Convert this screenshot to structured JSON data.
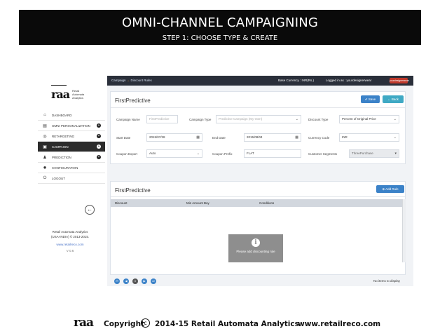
{
  "banner": {
    "title": "OMNI-CHANNEL CAMPAIGNING",
    "subtitle": "STEP 1: CHOOSE TYPE & CREATE"
  },
  "sidebar": {
    "logo_mark": "raa",
    "logo_sub": [
      "Retail",
      "Automata",
      "Analytics"
    ],
    "items": [
      {
        "label": "DASHBOARD",
        "icon": "home-icon",
        "glyph": "⌂",
        "expand": false,
        "active": false
      },
      {
        "label": "OMNI PERSONALIZATION",
        "icon": "cart-icon",
        "glyph": "🛒",
        "expand": true,
        "active": false
      },
      {
        "label": "RETARGETING",
        "icon": "target-icon",
        "glyph": "◎",
        "expand": true,
        "active": false
      },
      {
        "label": "CAMPAIGN",
        "icon": "document-icon",
        "glyph": "▣",
        "expand": true,
        "active": true
      },
      {
        "label": "PREDICTION",
        "icon": "user-icon",
        "glyph": "♟",
        "expand": true,
        "active": false
      },
      {
        "label": "CONFIGURATION",
        "icon": "gear-icon",
        "glyph": "✹",
        "expand": false,
        "active": false
      },
      {
        "label": "LOGOUT",
        "icon": "power-icon",
        "glyph": "⏻",
        "expand": false,
        "active": false
      }
    ],
    "collapse_glyph": "←",
    "footer": {
      "company": "Retail Automata Analytics",
      "copyright": "(USA-INDIA) © 2013-2015.",
      "link": "www.retailreco.com",
      "version": "V 0.6"
    }
  },
  "topbar": {
    "crumb_a": "Campaign",
    "crumb_arrow": "→",
    "crumb_b": "Discount Rules",
    "currency": "Base Currency : INR(Rs.)",
    "logged": "Logged in as : yourdesignerwear",
    "badge": "yourdesignerwear"
  },
  "form": {
    "title": "FirstPredictive",
    "save_label": "Save",
    "back_label": "Back",
    "campaign_name_label": "Campaign Name",
    "campaign_name_value": "FirstPredictive",
    "campaign_type_label": "Campaign Type",
    "campaign_type_value": "Predictive Campaign (My Own)",
    "discount_type_label": "Discount Type",
    "discount_type_value": "Percent of Original Price",
    "start_date_label": "Start Date",
    "start_date_value": "2015/07/28",
    "end_date_label": "End Date",
    "end_date_value": "2015/08/04",
    "currency_code_label": "Currency Code",
    "currency_code_value": "INR",
    "coupon_export_label": "Coupon Export",
    "coupon_export_value": "Auto",
    "coupon_prefix_label": "Coupon Prefix",
    "coupon_prefix_value": "FLAT",
    "customer_segments_label": "Customer Segments",
    "customer_segments_value": "ThreePurchase"
  },
  "rules": {
    "title": "FirstPredictive",
    "add_rule_label": "Add Rule",
    "columns": [
      "Discount",
      "Min Amount Buy",
      "Conditions"
    ],
    "empty_message": "Please add discounting rule",
    "no_items": "No items to display",
    "current_page": "0"
  },
  "footer": {
    "logo_mark": "raa",
    "copyright_word": "Copyright",
    "copyright_symbol": "c",
    "years_company": "2014-15  Retail Automata Analytics",
    "website": "www.retailreco.com"
  }
}
